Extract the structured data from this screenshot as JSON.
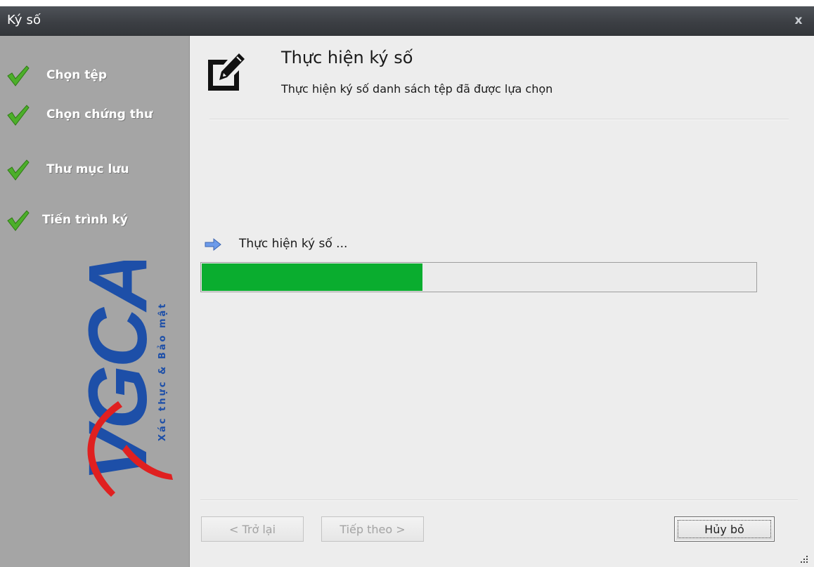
{
  "window": {
    "title": "Ký số",
    "close_label": "x"
  },
  "sidebar": {
    "steps": [
      {
        "label": "Chọn tệp",
        "done": true
      },
      {
        "label": "Chọn chứng thư",
        "done": true
      },
      {
        "label": "Thư mục lưu",
        "done": true
      },
      {
        "label": "Tiến trình ký",
        "done": true
      }
    ],
    "logo": {
      "text": "VGCA",
      "tagline": "Xác thực & Bảo mật"
    }
  },
  "header": {
    "title": "Thực hiện ký số",
    "subtitle": "Thực hiện ký số danh sách tệp đã được lựa chọn",
    "icon": "edit-icon"
  },
  "progress": {
    "status_text": "Thực hiện ký số ...",
    "percent": 40,
    "fill_color": "#0aad2f"
  },
  "buttons": {
    "back_label": "< Trở lại",
    "next_label": "Tiếp theo >",
    "cancel_label": "Hủy bỏ"
  },
  "colors": {
    "titlebar": "#3c3f44",
    "sidebar": "#a5a5a5",
    "check_green": "#4caf2a",
    "logo_blue": "#1d4fa8",
    "logo_red": "#e02020"
  }
}
